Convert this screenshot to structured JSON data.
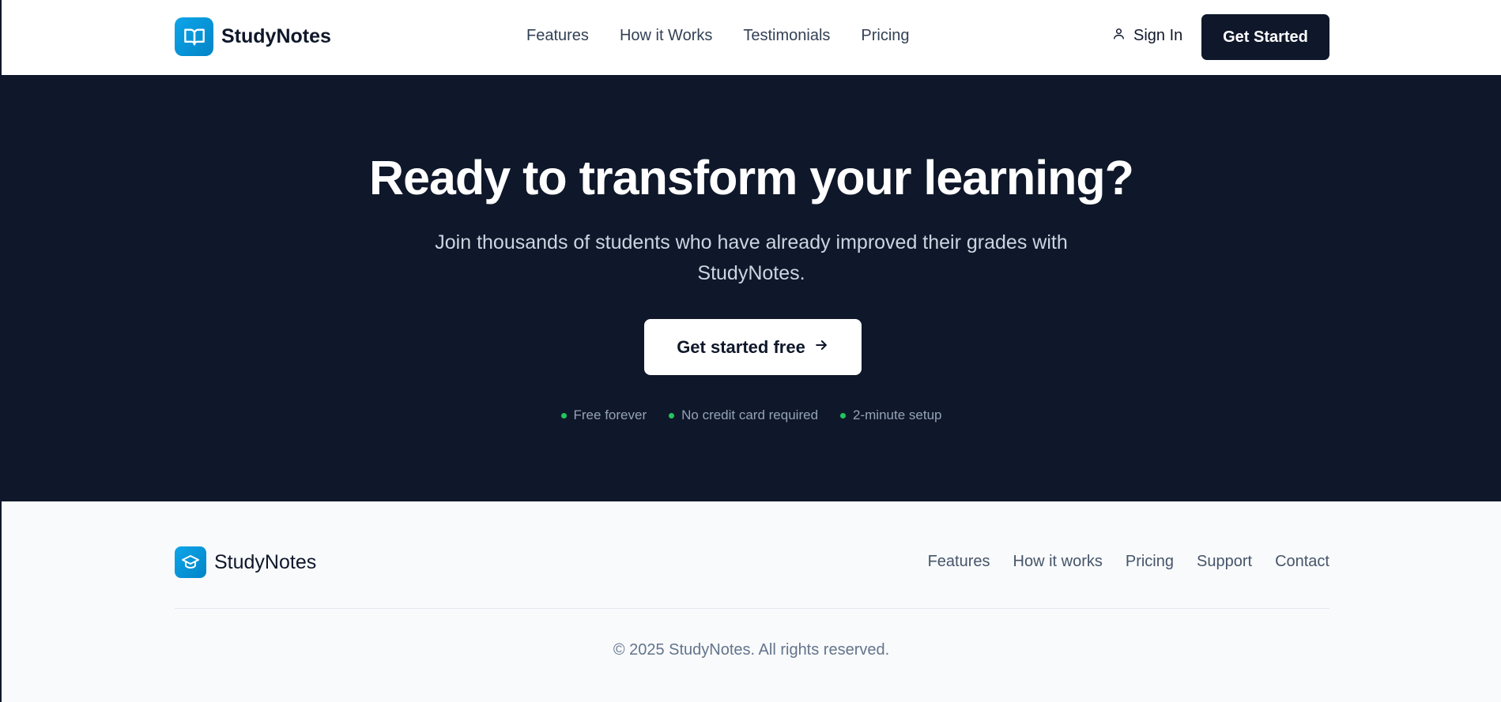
{
  "header": {
    "brand": "StudyNotes",
    "nav": [
      "Features",
      "How it Works",
      "Testimonials",
      "Pricing"
    ],
    "sign_in": "Sign In",
    "get_started": "Get Started"
  },
  "hero": {
    "title": "Ready to transform your learning?",
    "subtitle": "Join thousands of students who have already improved their grades with StudyNotes.",
    "cta": "Get started free",
    "perks": [
      "Free forever",
      "No credit card required",
      "2-minute setup"
    ]
  },
  "footer": {
    "brand": "StudyNotes",
    "links": [
      "Features",
      "How it works",
      "Pricing",
      "Support",
      "Contact"
    ],
    "copyright": "© 2025 StudyNotes. All rights reserved."
  },
  "colors": {
    "accent": "#0ea5e9",
    "dark": "#0f172a",
    "perk_dot": "#22c55e"
  }
}
